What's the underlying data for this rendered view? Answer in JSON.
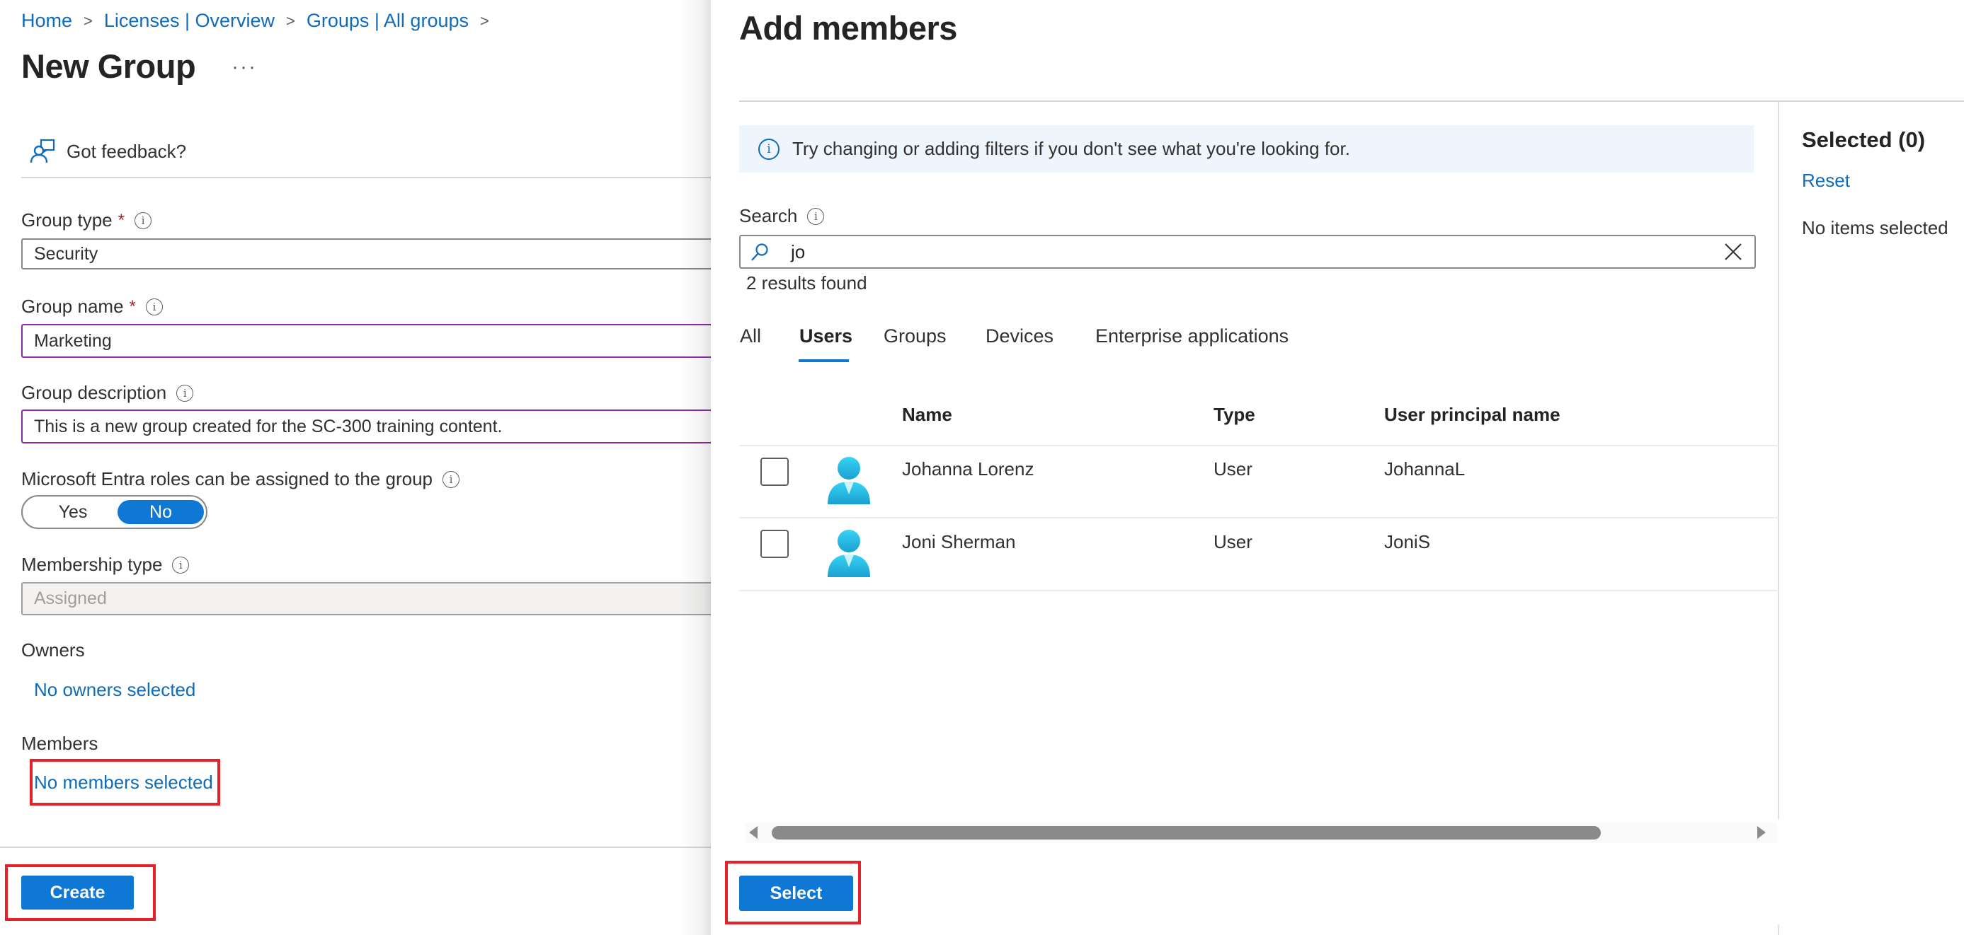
{
  "breadcrumb": [
    {
      "label": "Home"
    },
    {
      "label": "Licenses | Overview"
    },
    {
      "label": "Groups | All groups"
    }
  ],
  "page": {
    "title": "New Group",
    "more_label": "···",
    "feedback_label": "Got feedback?"
  },
  "form": {
    "group_type": {
      "label": "Group type",
      "required_mark": "*",
      "value": "Security"
    },
    "group_name": {
      "label": "Group name",
      "required_mark": "*",
      "value": "Marketing"
    },
    "group_description": {
      "label": "Group description",
      "value": "This is a new group created for the SC-300 training content."
    },
    "entra_roles": {
      "label": "Microsoft Entra roles can be assigned to the group",
      "options": [
        "Yes",
        "No"
      ],
      "selected": "No"
    },
    "membership_type": {
      "label": "Membership type",
      "value": "Assigned",
      "disabled": true
    },
    "owners": {
      "label": "Owners",
      "link": "No owners selected"
    },
    "members": {
      "label": "Members",
      "link": "No members selected"
    },
    "create_label": "Create"
  },
  "flyout": {
    "title": "Add members",
    "info_message": "Try changing or adding filters if you don't see what you're looking for.",
    "search": {
      "label": "Search",
      "value": "jo",
      "results_text": "2 results found"
    },
    "tabs": [
      {
        "label": "All",
        "active": false
      },
      {
        "label": "Users",
        "active": true
      },
      {
        "label": "Groups",
        "active": false
      },
      {
        "label": "Devices",
        "active": false
      },
      {
        "label": "Enterprise applications",
        "active": false
      }
    ],
    "table": {
      "columns": [
        "Name",
        "Type",
        "User principal name"
      ],
      "rows": [
        {
          "name": "Johanna Lorenz",
          "type": "User",
          "upn": "JohannaL",
          "checked": false,
          "icon": "user-avatar-icon"
        },
        {
          "name": "Joni Sherman",
          "type": "User",
          "upn": "JoniS",
          "checked": false,
          "icon": "user-avatar-icon"
        }
      ]
    },
    "selected": {
      "title": "Selected (0)",
      "reset_label": "Reset",
      "empty_text": "No items selected"
    },
    "select_label": "Select"
  },
  "colors": {
    "accent": "#0f78d4",
    "link": "#0f6cbd",
    "highlight_box": "#e3222b",
    "focus_border": "#8a2da5",
    "info_bar_bg": "#eef5fd"
  }
}
